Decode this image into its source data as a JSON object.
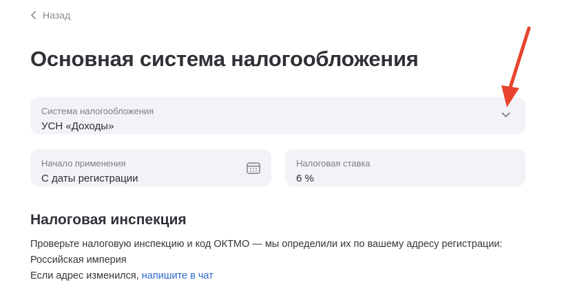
{
  "nav": {
    "back_label": "Назад"
  },
  "page_title": "Основная система налогообложения",
  "tax_system_field": {
    "label": "Система налогообложения",
    "value": "УСН «Доходы»",
    "icon": "chevron-down-icon"
  },
  "start_date_field": {
    "label": "Начало применения",
    "value": "С даты регистрации",
    "icon": "calendar-icon"
  },
  "tax_rate_field": {
    "label": "Налоговая ставка",
    "value": "6 %"
  },
  "inspection": {
    "title": "Налоговая инспекция",
    "description": "Проверьте налоговую инспекцию и код ОКТМО — мы определили их по вашему адресу регистрации:",
    "address": "Российская империя",
    "change_prefix": "Если адрес изменился, ",
    "change_link": "напишите в чат"
  },
  "colors": {
    "field_bg": "#f2f3f6",
    "link": "#2a69c9",
    "annotation_arrow": "#e8432e"
  }
}
